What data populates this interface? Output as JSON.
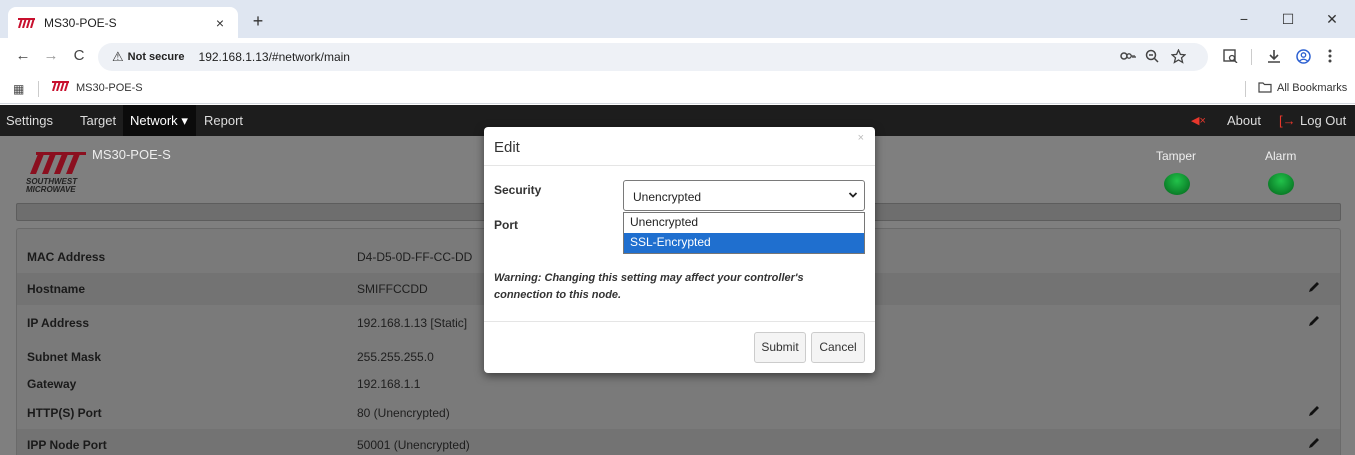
{
  "browser": {
    "tab_title": "MS30-POE-S",
    "tab_close": "×",
    "new_tab": "+",
    "minimize": "−",
    "maximize": "☐",
    "close": "✕",
    "back": "←",
    "forward": "→",
    "reload": "C",
    "security_warning_icon": "⚠",
    "security_label": "Not secure",
    "url": "192.168.1.13/#network/main",
    "bookmarks": {
      "apps_icon": "▦",
      "item_label": "MS30-POE-S",
      "all_bookmarks": "All Bookmarks"
    }
  },
  "nav": {
    "settings": "Settings",
    "target": "Target",
    "network": "Network",
    "network_caret": "▾",
    "report": "Report",
    "mute_icon": "◀×",
    "about": "About",
    "logout_icon": "[→",
    "logout": "Log Out"
  },
  "header": {
    "logo_line1": "SOUTHWEST",
    "logo_line2": "MICROWAVE",
    "device_name": "MS30-POE-S",
    "tamper_label": "Tamper",
    "alarm_label": "Alarm",
    "tamper_color": "#1a9e3a",
    "alarm_color": "#1a9e3a"
  },
  "table": {
    "rows": [
      {
        "label": "MAC Address",
        "value": "D4-D5-0D-FF-CC-DD",
        "editable": false
      },
      {
        "label": "Hostname",
        "value": "SMIFFCCDD",
        "editable": true
      },
      {
        "label": "IP Address",
        "value": "192.168.1.13 [Static]",
        "editable": true
      },
      {
        "label": "Subnet Mask",
        "value": "255.255.255.0",
        "editable": false
      },
      {
        "label": "Gateway",
        "value": "192.168.1.1",
        "editable": false
      },
      {
        "label": "HTTP(S) Port",
        "value": "80 (Unencrypted)",
        "editable": true
      },
      {
        "label": "IPP Node Port",
        "value": "50001 (Unencrypted)",
        "editable": true
      }
    ]
  },
  "modal": {
    "title": "Edit",
    "close": "×",
    "security_label": "Security",
    "security_value": "Unencrypted",
    "port_label": "Port",
    "options": [
      "Unencrypted",
      "SSL-Encrypted"
    ],
    "highlighted_option": "SSL-Encrypted",
    "warning": "Warning: Changing this setting may affect your controller's connection to this node.",
    "submit": "Submit",
    "cancel": "Cancel"
  },
  "colors": {
    "nav_bg": "#1d1d1d",
    "page_bg": "#7f7f7f",
    "option_highlight": "#1f6fcf",
    "logout_red": "#e8372c"
  }
}
